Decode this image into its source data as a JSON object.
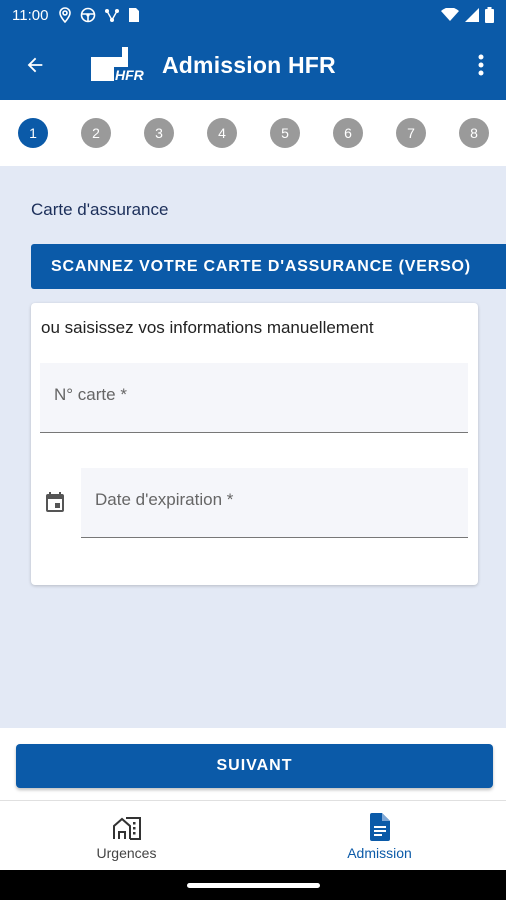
{
  "status_bar": {
    "time": "11:00"
  },
  "app_bar": {
    "title": "Admission HFR",
    "logo_text": "HFR"
  },
  "stepper": {
    "steps": [
      "1",
      "2",
      "3",
      "4",
      "5",
      "6",
      "7",
      "8"
    ],
    "active_step": "1"
  },
  "form": {
    "section_label": "Carte d'assurance",
    "scan_button": "SCANNEZ VOTRE CARTE D'ASSURANCE (VERSO)",
    "manual_hint": "ou saisissez vos informations manuellement",
    "card_number_label": "N° carte *",
    "expiry_label": "Date d'expiration *"
  },
  "actions": {
    "next_button": "SUIVANT"
  },
  "bottom_nav": {
    "items": [
      {
        "label": "Urgences",
        "icon": "house-city-icon",
        "active": false
      },
      {
        "label": "Admission",
        "icon": "document-icon",
        "active": true
      }
    ]
  },
  "colors": {
    "primary": "#0b5aa8",
    "background": "#e3e9f5",
    "step_inactive": "#9a9a9a"
  }
}
